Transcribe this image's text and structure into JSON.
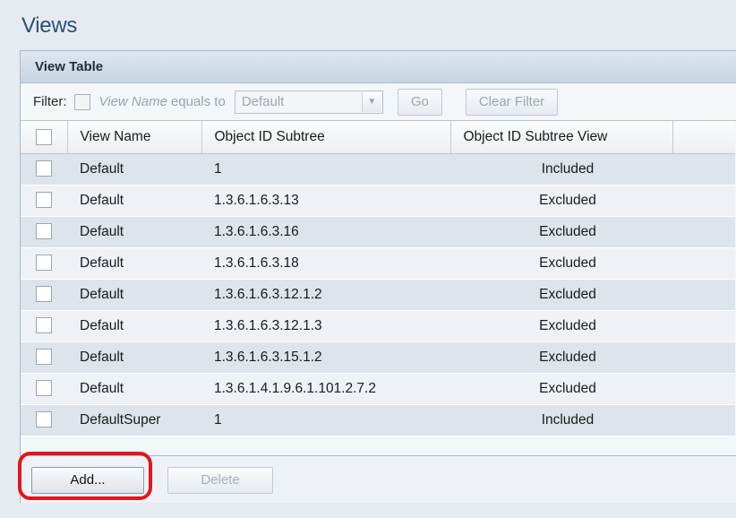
{
  "page": {
    "title": "Views"
  },
  "panel": {
    "title": "View Table"
  },
  "filter": {
    "label": "Filter:",
    "field": "View Name",
    "operator": "equals to",
    "value": "Default",
    "go_label": "Go",
    "clear_label": "Clear Filter"
  },
  "table": {
    "columns": [
      "View Name",
      "Object ID Subtree",
      "Object ID Subtree View"
    ],
    "rows": [
      {
        "view_name": "Default",
        "subtree": "1",
        "subtree_view": "Included"
      },
      {
        "view_name": "Default",
        "subtree": "1.3.6.1.6.3.13",
        "subtree_view": "Excluded"
      },
      {
        "view_name": "Default",
        "subtree": "1.3.6.1.6.3.16",
        "subtree_view": "Excluded"
      },
      {
        "view_name": "Default",
        "subtree": "1.3.6.1.6.3.18",
        "subtree_view": "Excluded"
      },
      {
        "view_name": "Default",
        "subtree": "1.3.6.1.6.3.12.1.2",
        "subtree_view": "Excluded"
      },
      {
        "view_name": "Default",
        "subtree": "1.3.6.1.6.3.12.1.3",
        "subtree_view": "Excluded"
      },
      {
        "view_name": "Default",
        "subtree": "1.3.6.1.6.3.15.1.2",
        "subtree_view": "Excluded"
      },
      {
        "view_name": "Default",
        "subtree": "1.3.6.1.4.1.9.6.1.101.2.7.2",
        "subtree_view": "Excluded"
      },
      {
        "view_name": "DefaultSuper",
        "subtree": "1",
        "subtree_view": "Included"
      }
    ]
  },
  "actions": {
    "add_label": "Add...",
    "delete_label": "Delete"
  },
  "colors": {
    "highlight": "#e4151c",
    "title": "#2e4e78"
  }
}
